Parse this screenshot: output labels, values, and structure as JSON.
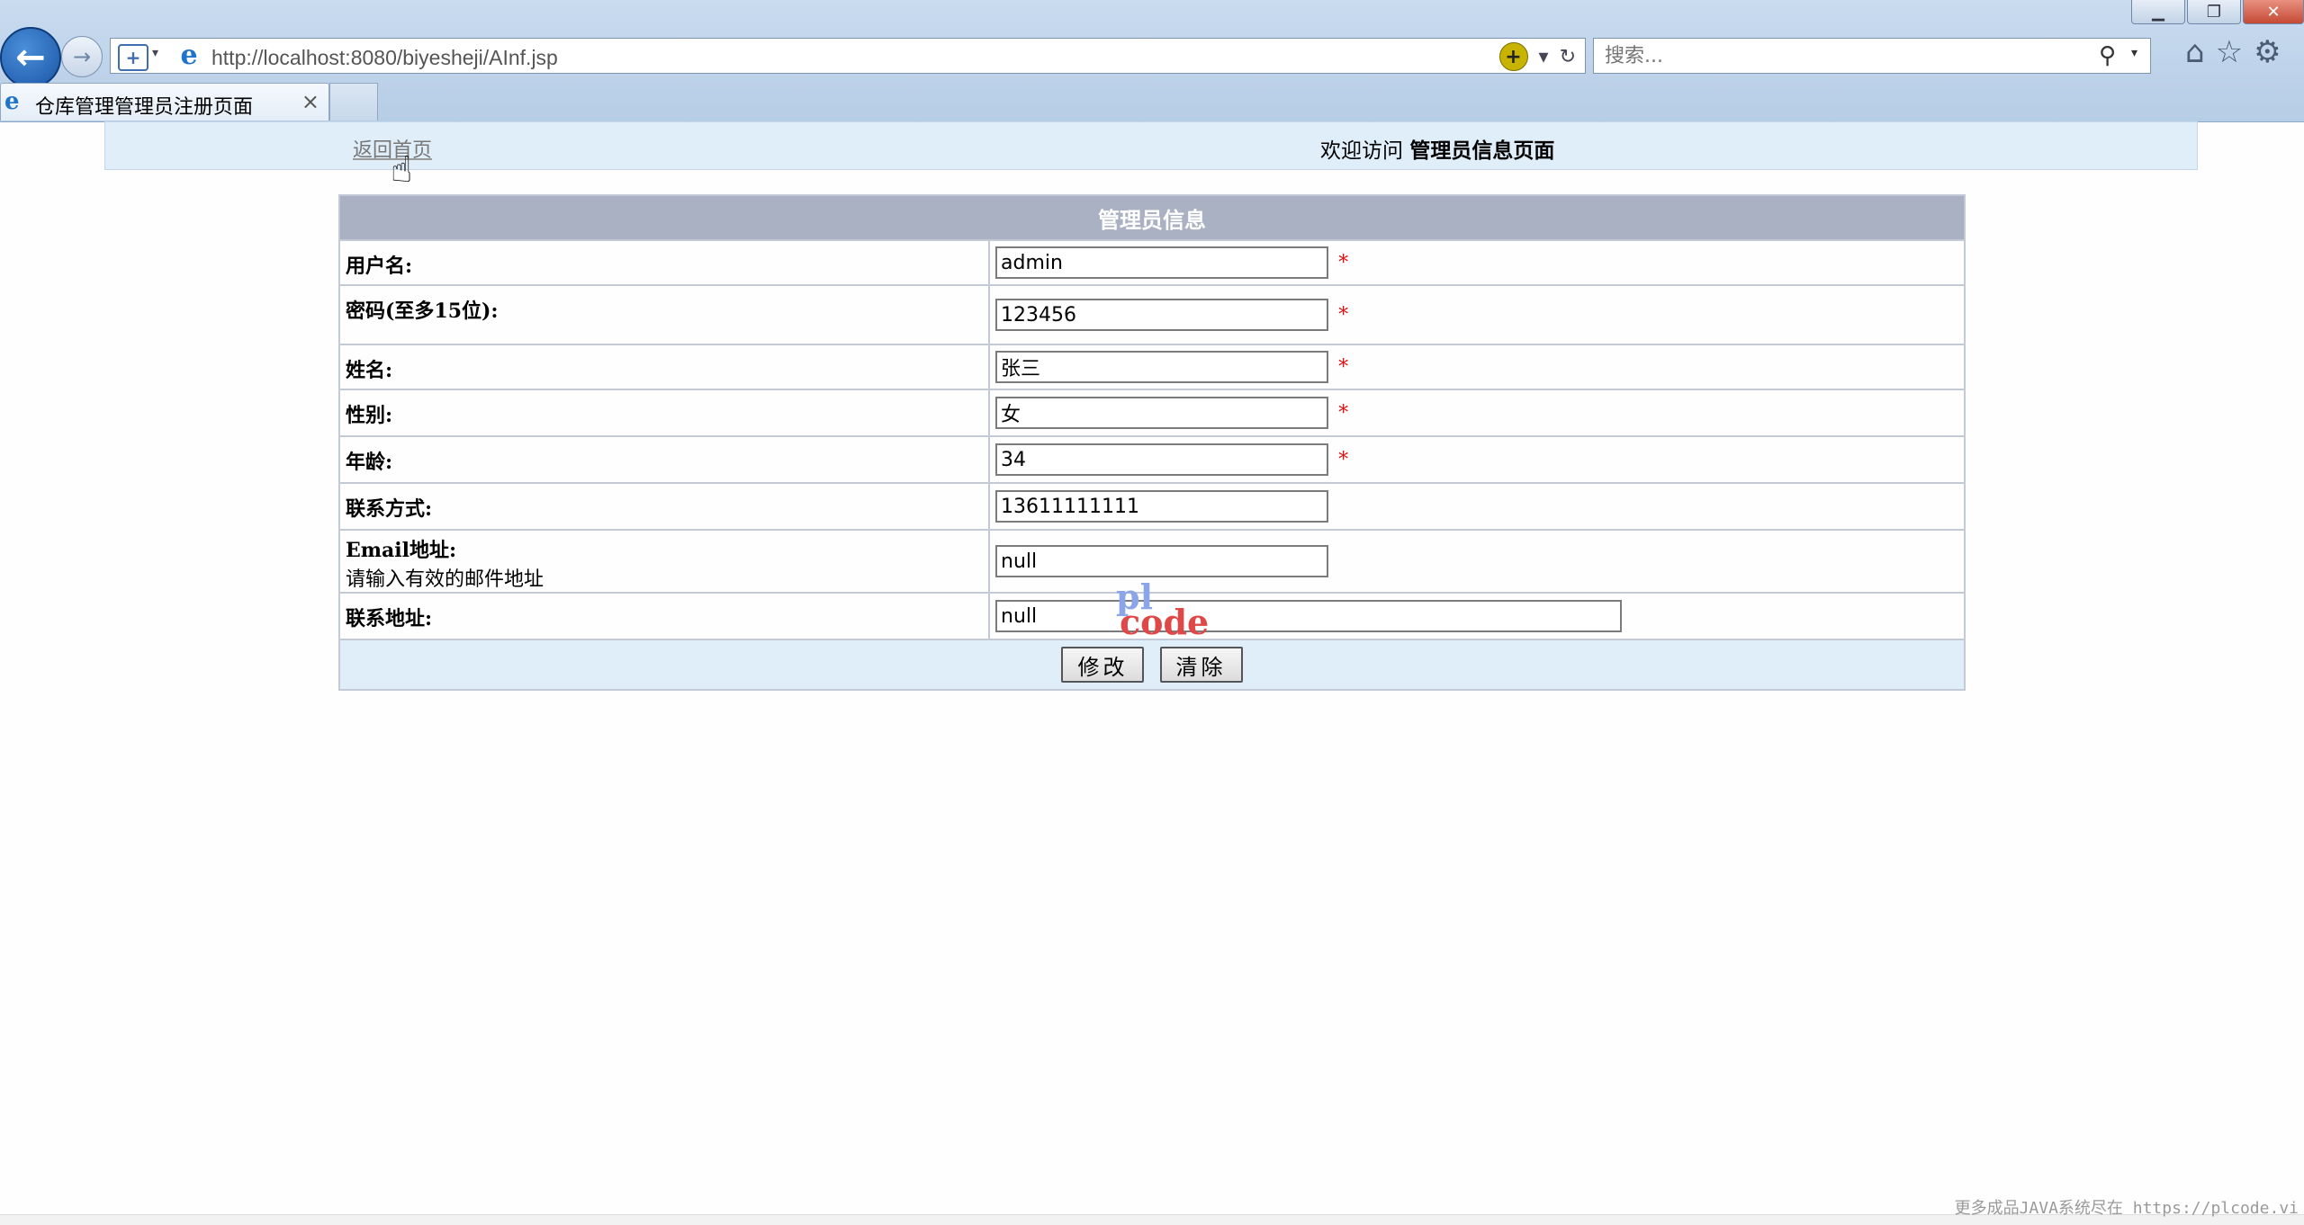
{
  "browser": {
    "url": "http://localhost:8080/biyesheji/AInf.jsp",
    "search_placeholder": "搜索...",
    "tab_title": "仓库管理管理员注册页面",
    "tab_close": "×",
    "window_buttons": [
      "minimize",
      "restore",
      "close"
    ]
  },
  "topbar": {
    "home_link": "返回首页",
    "welcome_prefix": "欢迎访问",
    "welcome_page": "管理员信息页面"
  },
  "form": {
    "title": "管理员信息",
    "rows": [
      {
        "label": "用户名:",
        "value": "admin",
        "required": "*"
      },
      {
        "label": "密码(至多15位):",
        "value": "123456",
        "required": "*"
      },
      {
        "label": "姓名:",
        "value": "张三",
        "required": "*"
      },
      {
        "label": "性别:",
        "value": "女",
        "required": "*"
      },
      {
        "label": "年龄:",
        "value": "34",
        "required": "*"
      },
      {
        "label": "联系方式:",
        "value": "13611111111"
      },
      {
        "label": "Email地址:",
        "hint": "请输入有效的邮件地址",
        "value": "null"
      },
      {
        "label": "联系地址:",
        "value": "null"
      }
    ],
    "buttons": {
      "modify": "修改",
      "clear": "清除"
    }
  },
  "watermark": {
    "line1": "pl",
    "line2": "code"
  },
  "footer_note": "更多成品JAVA系统尽在 https://plcode.vi"
}
